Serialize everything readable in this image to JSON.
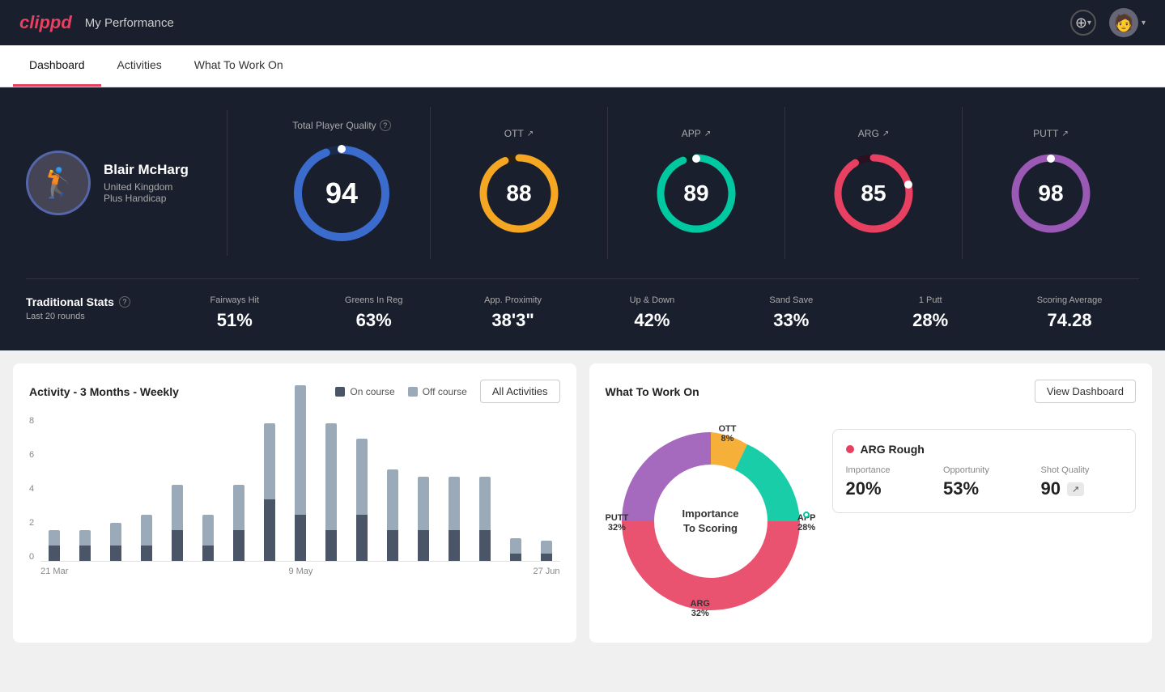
{
  "header": {
    "logo": "clippd",
    "title": "My Performance",
    "add_icon": "⊕",
    "avatar_icon": "👤",
    "dropdown_arrow": "▾"
  },
  "tabs": [
    {
      "label": "Dashboard",
      "active": true
    },
    {
      "label": "Activities",
      "active": false
    },
    {
      "label": "What To Work On",
      "active": false
    }
  ],
  "player": {
    "name": "Blair McHarg",
    "country": "United Kingdom",
    "handicap": "Plus Handicap"
  },
  "scores": {
    "total": {
      "label": "Total Player Quality",
      "value": 94,
      "color": "#3b6bcc",
      "track": "#1a2a4a"
    },
    "ott": {
      "label": "OTT",
      "value": 88,
      "color": "#f5a623",
      "track": "#2a2010"
    },
    "app": {
      "label": "APP",
      "value": 89,
      "color": "#00c8a0",
      "track": "#0a2520"
    },
    "arg": {
      "label": "ARG",
      "value": 85,
      "color": "#e84060",
      "track": "#2a1020"
    },
    "putt": {
      "label": "PUTT",
      "value": 98,
      "color": "#9b59b6",
      "track": "#1a0a2a"
    }
  },
  "traditional_stats": {
    "title": "Traditional Stats",
    "subtitle": "Last 20 rounds",
    "items": [
      {
        "label": "Fairways Hit",
        "value": "51%"
      },
      {
        "label": "Greens In Reg",
        "value": "63%"
      },
      {
        "label": "App. Proximity",
        "value": "38'3\""
      },
      {
        "label": "Up & Down",
        "value": "42%"
      },
      {
        "label": "Sand Save",
        "value": "33%"
      },
      {
        "label": "1 Putt",
        "value": "28%"
      },
      {
        "label": "Scoring Average",
        "value": "74.28"
      }
    ]
  },
  "activity_chart": {
    "title": "Activity - 3 Months - Weekly",
    "legend": {
      "on_course": "On course",
      "off_course": "Off course"
    },
    "all_activities_btn": "All Activities",
    "x_labels": [
      "21 Mar",
      "9 May",
      "27 Jun"
    ],
    "y_labels": [
      "8",
      "6",
      "4",
      "2",
      "0"
    ],
    "bars": [
      {
        "on": 1,
        "off": 1
      },
      {
        "on": 1,
        "off": 1
      },
      {
        "on": 1,
        "off": 1.5
      },
      {
        "on": 1,
        "off": 2
      },
      {
        "on": 2,
        "off": 3
      },
      {
        "on": 1,
        "off": 2
      },
      {
        "on": 2,
        "off": 3
      },
      {
        "on": 4,
        "off": 5
      },
      {
        "on": 3,
        "off": 8.5
      },
      {
        "on": 2,
        "off": 7
      },
      {
        "on": 3,
        "off": 5
      },
      {
        "on": 2,
        "off": 4
      },
      {
        "on": 2,
        "off": 3.5
      },
      {
        "on": 2,
        "off": 3.5
      },
      {
        "on": 2,
        "off": 3.5
      },
      {
        "on": 0.5,
        "off": 1
      },
      {
        "on": 0.5,
        "off": 0.8
      }
    ]
  },
  "what_to_work_on": {
    "title": "What To Work On",
    "view_dashboard_btn": "View Dashboard",
    "donut_label": "Importance\nTo Scoring",
    "segments": [
      {
        "label": "OTT",
        "pct": "8%",
        "color": "#f5a623",
        "position": "top"
      },
      {
        "label": "APP",
        "pct": "28%",
        "color": "#00c8a0",
        "position": "right"
      },
      {
        "label": "ARG",
        "pct": "32%",
        "color": "#e84060",
        "position": "bottom"
      },
      {
        "label": "PUTT",
        "pct": "32%",
        "color": "#9b59b6",
        "position": "left"
      }
    ],
    "info_card": {
      "title": "ARG Rough",
      "dot_color": "#e84060",
      "metrics": [
        {
          "label": "Importance",
          "value": "20%"
        },
        {
          "label": "Opportunity",
          "value": "53%"
        },
        {
          "label": "Shot Quality",
          "value": "90"
        }
      ]
    }
  }
}
